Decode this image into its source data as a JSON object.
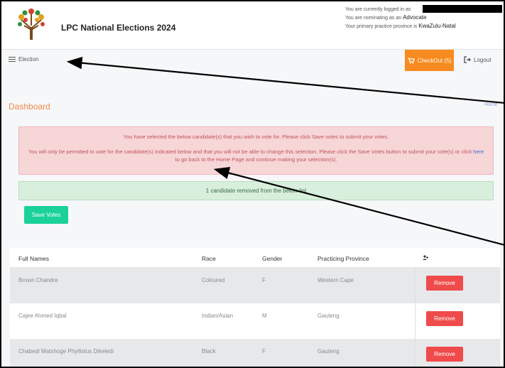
{
  "header": {
    "title": "LPC National Elections 2024",
    "login_line1": "You are currently logged in as",
    "login_line2_prefix": "You are nominating as an",
    "login_line2_role": "Advocate",
    "login_line3_prefix": "Your primary practice province is",
    "login_line3_province": "KwaZulu-Natal"
  },
  "nav": {
    "election": "Election",
    "checkout": "CheckOut (5)",
    "logout": "Logout"
  },
  "page": {
    "title": "Dashboard",
    "home": "Home"
  },
  "alert": {
    "line1": "You have selected the below candidate(s) that you wish to vote for. Please click Save votes to submit your votes.",
    "line2_before": "You will only be permitted to vote for the candidate(s) indicated below and that you will not be able to change this selection. Please click the Save Votes button to submit your vote(s) or click ",
    "line2_link": "here",
    "line2_after": " to go back to the Home Page and continue making your selection(s).",
    "success": "1 candidate removed from the below list"
  },
  "save_votes": "Save Votes",
  "table": {
    "headers": [
      "Full Names",
      "Race",
      "Gender",
      "Practicing Province"
    ],
    "rows": [
      {
        "name": "Brown Chandre",
        "race": "Coloured",
        "gender": "F",
        "province": "Western Cape",
        "action": "Remove"
      },
      {
        "name": "Cajee Ahmed Iqbal",
        "race": "Indian/Asian",
        "gender": "M",
        "province": "Gauteng",
        "action": "Remove"
      },
      {
        "name": "Chabedi Matshoge Phyllistus Dikeledi",
        "race": "Black",
        "gender": "F",
        "province": "Gauteng",
        "action": "Remove"
      }
    ]
  },
  "colors": {
    "accent_orange": "#f78b1f",
    "save_green": "#1ad199",
    "remove_red": "#ef4b4b"
  },
  "icons": [
    "logo-tree-icon",
    "hamburger-icon",
    "cart-icon",
    "logout-icon",
    "person-add-icon"
  ]
}
